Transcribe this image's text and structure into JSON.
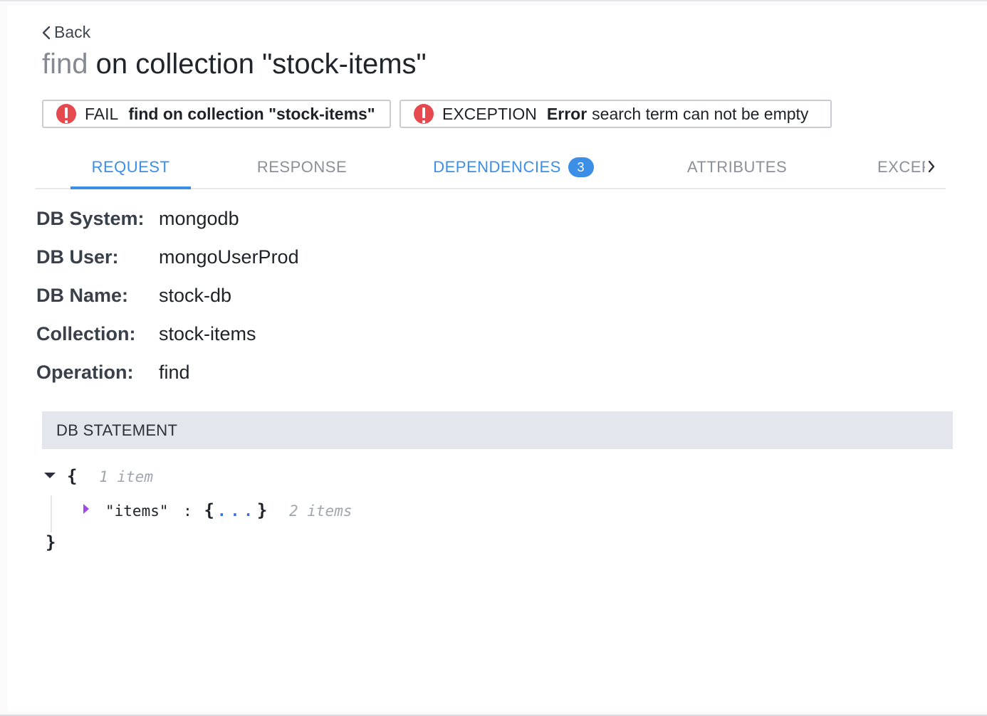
{
  "nav": {
    "back_label": "Back"
  },
  "header": {
    "title_operation": "find",
    "title_rest": "on collection \"stock-items\""
  },
  "badges": [
    {
      "status": "FAIL",
      "text": "find on collection \"stock-items\""
    },
    {
      "status": "EXCEPTION",
      "bold": "Error",
      "text": "search term can not be empty"
    }
  ],
  "tabs": [
    {
      "label": "REQUEST"
    },
    {
      "label": "RESPONSE"
    },
    {
      "label": "DEPENDENCIES",
      "count": "3"
    },
    {
      "label": "ATTRIBUTES"
    },
    {
      "label": "EXCEPTIONS"
    }
  ],
  "request": {
    "fields": [
      {
        "key": "DB System:",
        "value": "mongodb"
      },
      {
        "key": "DB User:",
        "value": "mongoUserProd"
      },
      {
        "key": "DB Name:",
        "value": "stock-db"
      },
      {
        "key": "Collection:",
        "value": "stock-items"
      },
      {
        "key": "Operation:",
        "value": "find"
      }
    ],
    "statement_heading": "DB STATEMENT",
    "statement": {
      "open_brace": "{",
      "close_brace": "}",
      "root_count": "1 item",
      "child_key": "\"items\"",
      "child_sep": ":",
      "child_open": "{",
      "child_dots": "...",
      "child_close": "}",
      "child_count": "2 items"
    }
  },
  "colors": {
    "accent": "#3b8fe6",
    "alert": "#e5484d",
    "section_bg": "#e3e6ec",
    "tree_caret": "#a04be8"
  }
}
